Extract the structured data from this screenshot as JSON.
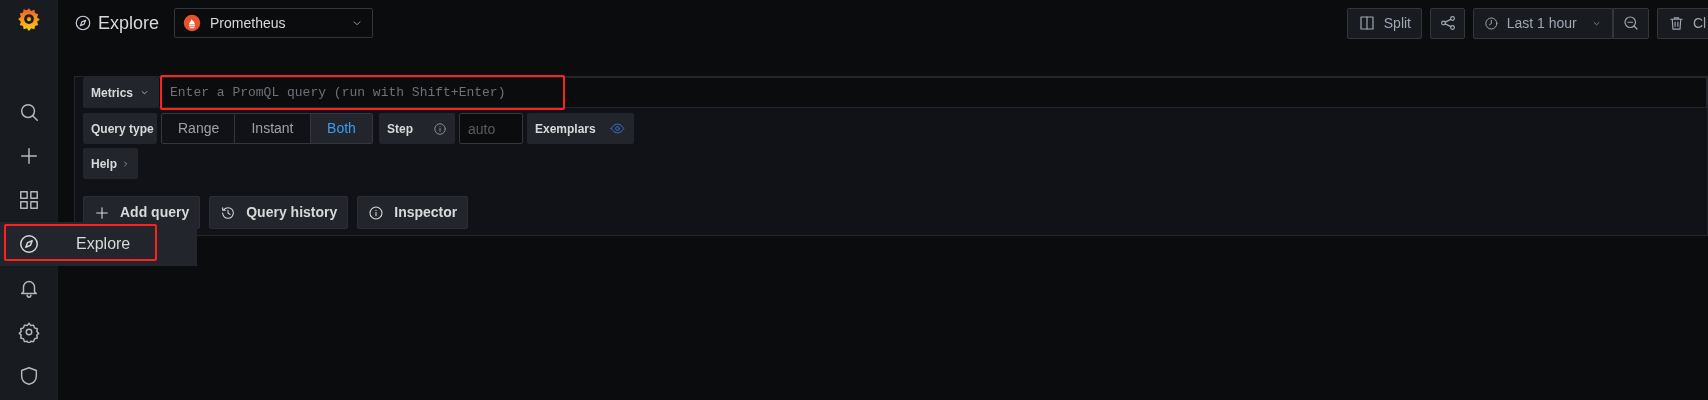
{
  "sidebar": {
    "items": [
      {
        "selected": false,
        "highlighted": false
      },
      {
        "selected": false,
        "highlighted": false
      },
      {
        "selected": false,
        "highlighted": false
      },
      {
        "selected": true,
        "highlighted": true,
        "flyout": "Explore"
      },
      {
        "selected": false,
        "highlighted": false
      },
      {
        "selected": false,
        "highlighted": false
      },
      {
        "selected": false,
        "highlighted": false
      }
    ]
  },
  "header": {
    "title": "Explore",
    "datasource": "Prometheus",
    "toolbar": [
      {
        "kind": "split",
        "label": "Split"
      },
      {
        "kind": "share"
      },
      {
        "kind": "time",
        "label": "Last 1 hour"
      },
      {
        "kind": "zoom"
      },
      {
        "kind": "clear",
        "label": "Cl"
      }
    ]
  },
  "query": {
    "metrics_label": "Metrics",
    "placeholder": "Enter a PromQL query (run with Shift+Enter)",
    "highlighted": true,
    "query_type_label": "Query type",
    "query_types": [
      {
        "label": "Range",
        "selected": false
      },
      {
        "label": "Instant",
        "selected": false
      },
      {
        "label": "Both",
        "selected": true
      }
    ],
    "step_label": "Step",
    "step_placeholder": "auto",
    "exemplars_label": "Exemplars",
    "help": "Help"
  },
  "actions": [
    {
      "label": "Add query"
    },
    {
      "label": "Query history"
    },
    {
      "label": "Inspector"
    }
  ]
}
